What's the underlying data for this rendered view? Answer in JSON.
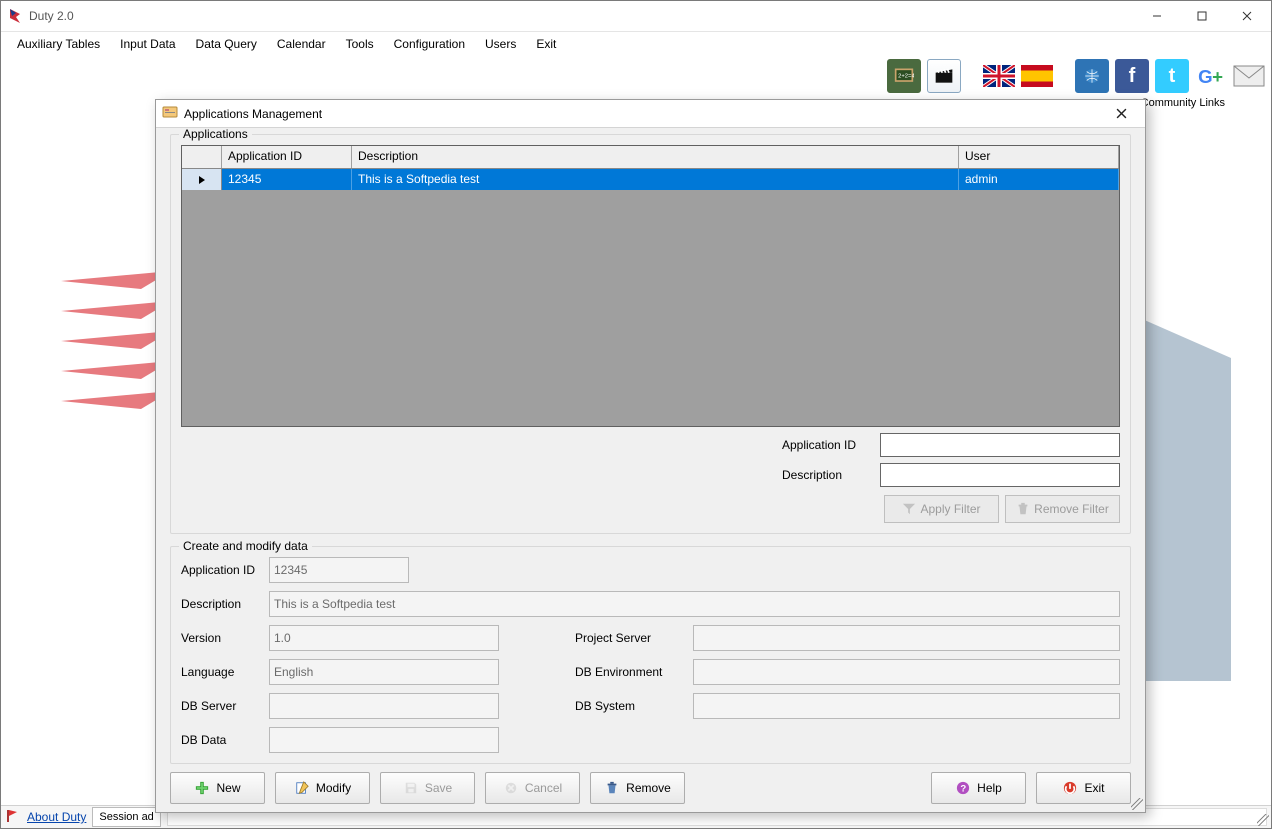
{
  "main_window": {
    "title": "Duty 2.0",
    "menu": [
      "Auxiliary Tables",
      "Input Data",
      "Data Query",
      "Calendar",
      "Tools",
      "Configuration",
      "Users",
      "Exit"
    ],
    "community_label": "Community Links",
    "status": {
      "about_label": "About Duty",
      "session_label": "Session ad"
    }
  },
  "dialog": {
    "title": "Applications Management",
    "groups": {
      "applications_legend": "Applications",
      "form_legend": "Create and modify data"
    },
    "grid": {
      "headers": {
        "appid": "Application ID",
        "desc": "Description",
        "user": "User"
      },
      "rows": [
        {
          "appid": "12345",
          "desc": "This is a Softpedia test",
          "user": "admin"
        }
      ]
    },
    "filter": {
      "appid_label": "Application ID",
      "desc_label": "Description",
      "appid_value": "",
      "desc_value": "",
      "apply_label": "Apply Filter",
      "remove_label": "Remove Filter"
    },
    "form": {
      "fields": {
        "appid": {
          "label": "Application ID",
          "value": "12345"
        },
        "desc": {
          "label": "Description",
          "value": "This is a Softpedia test"
        },
        "version": {
          "label": "Version",
          "value": "1.0"
        },
        "project_server": {
          "label": "Project Server",
          "value": ""
        },
        "language": {
          "label": "Language",
          "value": "English"
        },
        "db_env": {
          "label": "DB Environment",
          "value": ""
        },
        "db_server": {
          "label": "DB Server",
          "value": ""
        },
        "db_system": {
          "label": "DB System",
          "value": ""
        },
        "db_data": {
          "label": "DB Data",
          "value": ""
        }
      }
    },
    "buttons": {
      "new": "New",
      "modify": "Modify",
      "save": "Save",
      "cancel": "Cancel",
      "remove": "Remove",
      "help": "Help",
      "exit": "Exit"
    }
  }
}
